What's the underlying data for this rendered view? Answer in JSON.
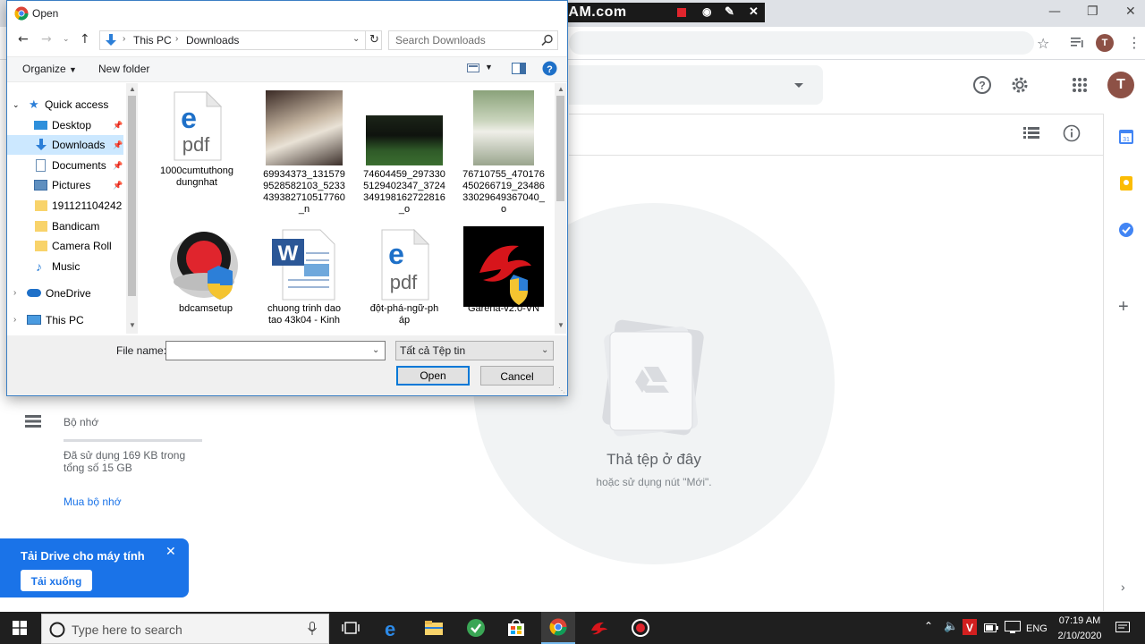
{
  "chrome": {
    "tab_initial": "T",
    "profile_initial": "T"
  },
  "drive": {
    "account_initial": "T",
    "drop_title": "Thả tệp ở đây",
    "drop_hint": "hoặc sử dụng nút \"Mới\".",
    "storage_label": "Bộ nhớ",
    "storage_usage": "Đã sử dụng 169 KB trong tổng số 15 GB",
    "buy_storage": "Mua bộ nhớ",
    "storage_used_fraction": 0.0
  },
  "toast": {
    "title": "Tải Drive cho máy tính",
    "button": "Tải xuống"
  },
  "bandicam": {
    "label": "www.BANDICAM.com"
  },
  "dialog": {
    "title": "Open",
    "breadcrumb": [
      "This PC",
      "Downloads"
    ],
    "search_placeholder": "Search Downloads",
    "organize": "Organize",
    "new_folder": "New folder",
    "nav": [
      {
        "label": "Quick access",
        "icon": "star-icon"
      },
      {
        "label": "Desktop",
        "icon": "desktop-icon",
        "pinned": true
      },
      {
        "label": "Downloads",
        "icon": "download-icon",
        "pinned": true,
        "selected": true
      },
      {
        "label": "Documents",
        "icon": "documents-icon",
        "pinned": true
      },
      {
        "label": "Pictures",
        "icon": "pictures-icon",
        "pinned": true
      },
      {
        "label": "191121104242",
        "icon": "folder-icon"
      },
      {
        "label": "Bandicam",
        "icon": "folder-icon"
      },
      {
        "label": "Camera Roll",
        "icon": "folder-icon"
      },
      {
        "label": "Music",
        "icon": "music-icon"
      },
      {
        "label": "OneDrive",
        "icon": "cloud-icon"
      },
      {
        "label": "This PC",
        "icon": "pc-icon"
      }
    ],
    "files": [
      {
        "name": "1000cumtuthong\ndungnhat",
        "type": "pdf"
      },
      {
        "name": "69934373_131579\n9528582103_5233\n439382710517760\n_n",
        "type": "photo"
      },
      {
        "name": "74604459_297330\n5129402347_3724\n349198162722816\n_o",
        "type": "photo"
      },
      {
        "name": "76710755_470176\n450266719_23486\n33029649367040_\no",
        "type": "photo"
      },
      {
        "name": "bdcamsetup",
        "type": "installer"
      },
      {
        "name": "chuong trinh dao\ntao 43k04 - Kinh",
        "type": "word"
      },
      {
        "name": "đột-phá-ngữ-ph\náp",
        "type": "pdf"
      },
      {
        "name": "Garena-v2.0-VN",
        "type": "garena"
      }
    ],
    "file_name_label": "File name:",
    "file_name_value": "",
    "filter": "Tất cả Tệp tin",
    "open_button": "Open",
    "cancel_button": "Cancel"
  },
  "taskbar": {
    "search_placeholder": "Type here to search",
    "time": "07:19 AM",
    "date": "2/10/2020",
    "lang": "ENG"
  }
}
